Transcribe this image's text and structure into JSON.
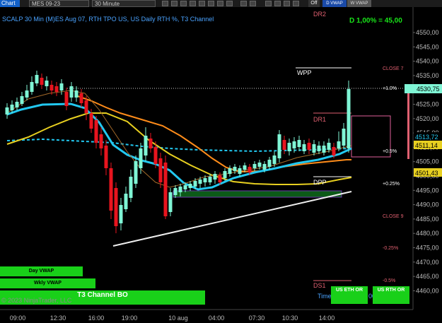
{
  "toolbar": {
    "chart_tab": "Chart",
    "instrument": "MES 09-23",
    "interval": "30 Minute",
    "off_label": "Off",
    "d_vwap": "D VWAP",
    "w_vwap": "W VWAP"
  },
  "header": {
    "title": "SCALP 30 Min (M)ES Aug 07, RTH TPO US, US Daily RTH %, T3 Channel",
    "pct_readout": "D 1,00% = 45,00"
  },
  "axes": {
    "y_ticks": [
      "4550,00",
      "4545,00",
      "4540,00",
      "4535,00",
      "4530,00",
      "4525,00",
      "4520,00",
      "4515,00",
      "4510,00",
      "4505,00",
      "4500,00",
      "4495,00",
      "4490,00",
      "4485,00",
      "4480,00",
      "4475,00",
      "4470,00",
      "4465,00",
      "4460,00"
    ],
    "x_ticks": [
      "09:00",
      "12:30",
      "16:00",
      "19:00",
      "10 aug",
      "04:00",
      "07:30",
      "10:30",
      "14:00"
    ]
  },
  "levels": {
    "dr2": "DR2",
    "wpp": "WPP",
    "dr1": "DR1",
    "dpp": "DPP",
    "ds1": "DS1",
    "close_7": "CLOSE 7",
    "close_9": "CLOSE 9",
    "p_plus_1": "+1.0%",
    "p_plus_05": "+0.5%",
    "p_plus_025": "+0.25%",
    "p_minus_025": "-0.25%",
    "p_minus_05": "-0.5%"
  },
  "price_tags": {
    "last": "4530,75",
    "tag_2": "4513,72",
    "tag_3": "4511,14",
    "tag_4": "4501,43"
  },
  "panel": {
    "day_vwap": "Day VWAP",
    "wkly_vwap": "Wkly VWAP",
    "t3_channel": "T3 Channel BO",
    "copyright": "© 2023 NinjaTrader, LLC",
    "time_remaining": "Time remaining = 00:09:02",
    "us_eth": "US ETH OR",
    "us_rth": "US RTH OR"
  },
  "colors": {
    "up": "#7ff5d5",
    "down": "#e8141e",
    "ema": "#ff8c1a",
    "vwap": "#22c8f0",
    "sma": "#e8d020",
    "level": "#e06070"
  }
}
